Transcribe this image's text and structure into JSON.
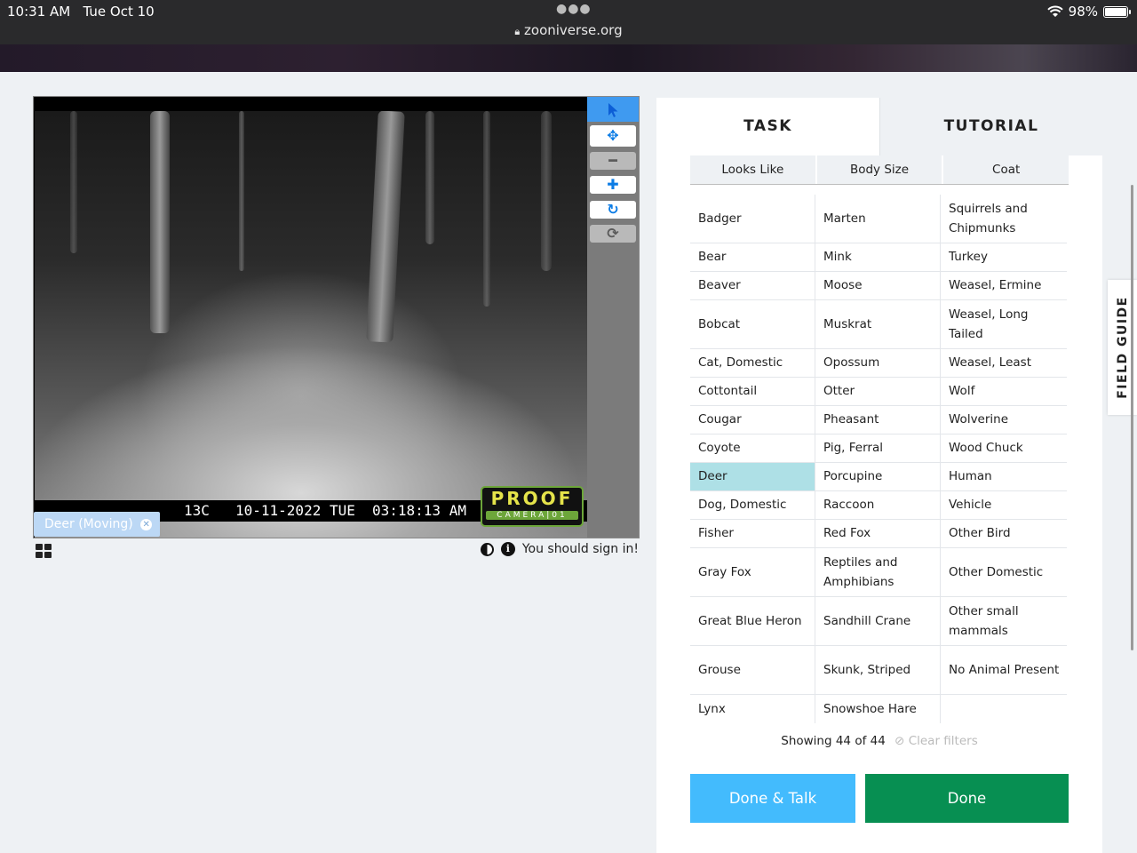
{
  "status_bar": {
    "time": "10:31 AM",
    "date": "Tue Oct 10",
    "url": "zooniverse.org",
    "battery": "98%",
    "battery_level": 0.98
  },
  "viewer": {
    "stamp": {
      "temp": "13C",
      "date": "10-11-2022 TUE",
      "time": "03:18:13 AM"
    },
    "camera_logo": {
      "big": "PROOF",
      "small": "CAMERA|01"
    },
    "mark_label": "Deer (Moving)",
    "tools": [
      "pointer-icon",
      "move-icon",
      "zoom-out-icon",
      "zoom-in-icon",
      "rotate-icon",
      "reset-icon"
    ],
    "sign_in_message": "You should sign in!"
  },
  "panel": {
    "tabs": {
      "task": "TASK",
      "tutorial": "TUTORIAL"
    },
    "filters": [
      "Looks Like",
      "Body Size",
      "Coat"
    ],
    "choices": [
      [
        "Badger",
        "Marten",
        "Squirrels and Chipmunks"
      ],
      [
        "Bear",
        "Mink",
        "Turkey"
      ],
      [
        "Beaver",
        "Moose",
        "Weasel, Ermine"
      ],
      [
        "Bobcat",
        "Muskrat",
        "Weasel, Long Tailed"
      ],
      [
        "Cat, Domestic",
        "Opossum",
        "Weasel, Least"
      ],
      [
        "Cottontail",
        "Otter",
        "Wolf"
      ],
      [
        "Cougar",
        "Pheasant",
        "Wolverine"
      ],
      [
        "Coyote",
        "Pig, Ferral",
        "Wood Chuck"
      ],
      [
        "Deer",
        "Porcupine",
        "Human"
      ],
      [
        "Dog, Domestic",
        "Raccoon",
        "Vehicle"
      ],
      [
        "Fisher",
        "Red Fox",
        "Other Bird"
      ],
      [
        "Gray Fox",
        "Reptiles and Amphibians",
        "Other Domestic"
      ],
      [
        "Great Blue Heron",
        "Sandhill Crane",
        "Other small mammals"
      ],
      [
        "Grouse",
        "Skunk, Striped",
        "No Animal Present"
      ],
      [
        "Lynx",
        "Snowshoe Hare",
        ""
      ]
    ],
    "selected_choice": "Deer",
    "showing": "Showing 44 of 44",
    "clear_filters": "Clear filters",
    "done_talk": "Done & Talk",
    "done": "Done",
    "field_guide": "FIELD GUIDE"
  }
}
